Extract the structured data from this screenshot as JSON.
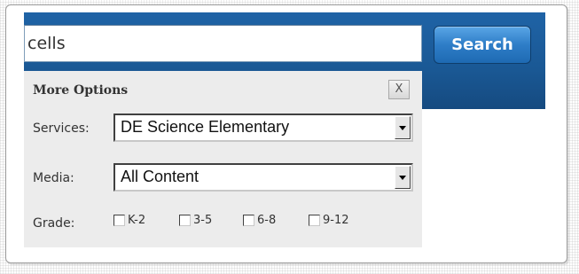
{
  "search": {
    "value": "cells",
    "button_label": "Search"
  },
  "more_options": {
    "title": "More Options",
    "close_label": "X",
    "services": {
      "label": "Services:",
      "selected": "DE Science Elementary"
    },
    "media": {
      "label": "Media:",
      "selected": "All Content"
    },
    "grade": {
      "label": "Grade:",
      "options": [
        {
          "label": "K-2",
          "checked": false
        },
        {
          "label": "3-5",
          "checked": false
        },
        {
          "label": "6-8",
          "checked": false
        },
        {
          "label": "9-12",
          "checked": false
        }
      ]
    }
  },
  "colors": {
    "header_blue": "#1a5894",
    "button_blue": "#2e7dc7",
    "panel_gray": "#ececec"
  }
}
